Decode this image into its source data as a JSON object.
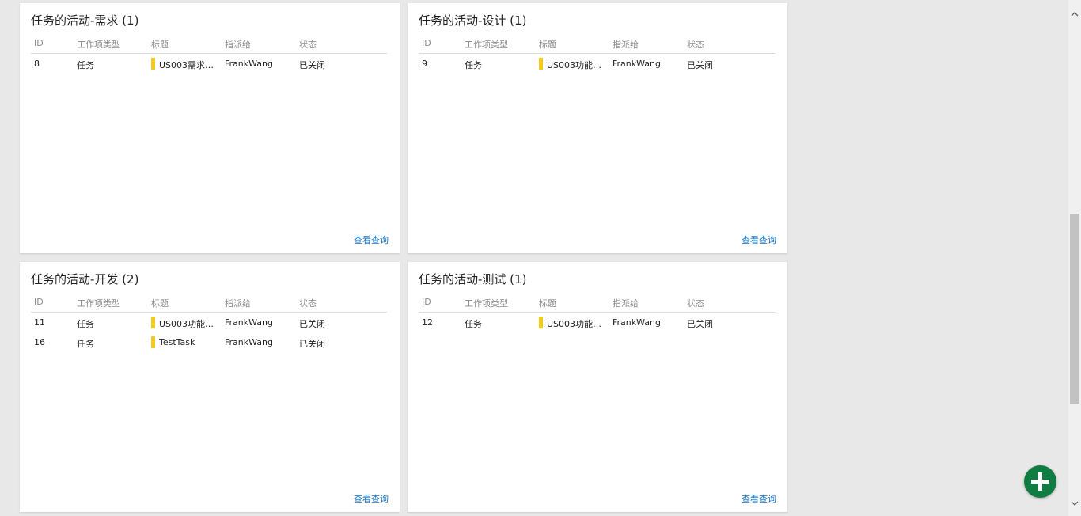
{
  "columns": {
    "id": "ID",
    "type": "工作项类型",
    "title": "标题",
    "assigned": "指派给",
    "state": "状态"
  },
  "widgets": [
    {
      "title": "任务的活动-需求 (1)",
      "link": "查看查询",
      "rows": [
        {
          "id": "8",
          "type": "任务",
          "title": "US003需求拆…",
          "assigned": "FrankWang",
          "state": "已关闭"
        }
      ]
    },
    {
      "title": "任务的活动-设计 (1)",
      "link": "查看查询",
      "rows": [
        {
          "id": "9",
          "type": "任务",
          "title": "US003功能设…",
          "assigned": "FrankWang",
          "state": "已关闭"
        }
      ]
    },
    {
      "title": "任务的活动-开发 (2)",
      "link": "查看查询",
      "rows": [
        {
          "id": "11",
          "type": "任务",
          "title": "US003功能实…",
          "assigned": "FrankWang",
          "state": "已关闭"
        },
        {
          "id": "16",
          "type": "任务",
          "title": "TestTask",
          "assigned": "FrankWang",
          "state": "已关闭"
        }
      ]
    },
    {
      "title": "任务的活动-测试 (1)",
      "link": "查看查询",
      "rows": [
        {
          "id": "12",
          "type": "任务",
          "title": "US003功能测…",
          "assigned": "FrankWang",
          "state": "已关闭"
        }
      ]
    }
  ],
  "colors": {
    "task_color": "#f2cb1d",
    "link": "#106ebe",
    "fab": "#107c41"
  },
  "icons": {
    "add": "plus-icon",
    "scroll_up": "chevron-up-icon",
    "scroll_down": "chevron-down-icon"
  }
}
